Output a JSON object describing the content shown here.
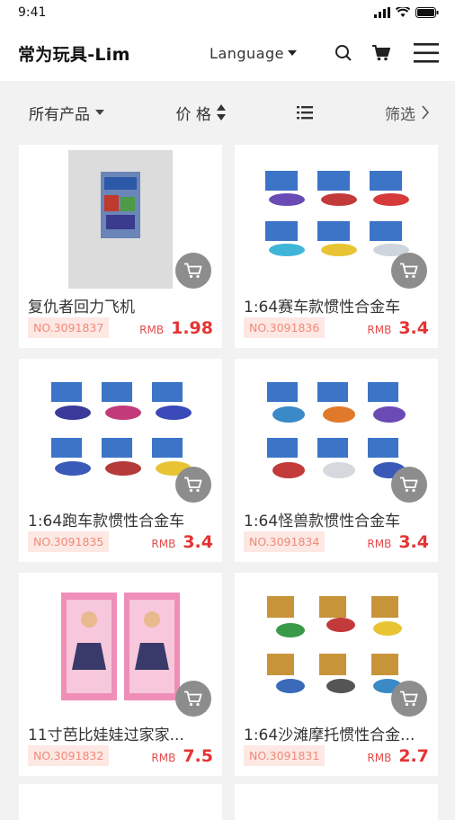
{
  "status": {
    "time": "9:41"
  },
  "header": {
    "brand": "常为玩具-Lim",
    "language": "Language"
  },
  "filters": {
    "all_products": "所有产品",
    "price": "价 格",
    "filter": "筛选"
  },
  "products": [
    {
      "name": "复仇者回力飞机",
      "sku": "NO.3091837",
      "currency": "RMB",
      "price": "1.98"
    },
    {
      "name": "1:64赛车款惯性合金车",
      "sku": "NO.3091836",
      "currency": "RMB",
      "price": "3.4"
    },
    {
      "name": "1:64跑车款惯性合金车",
      "sku": "NO.3091835",
      "currency": "RMB",
      "price": "3.4"
    },
    {
      "name": "1:64怪兽款惯性合金车",
      "sku": "NO.3091834",
      "currency": "RMB",
      "price": "3.4"
    },
    {
      "name": "11寸芭比娃娃过家家...",
      "sku": "NO.3091832",
      "currency": "RMB",
      "price": "7.5"
    },
    {
      "name": "1:64沙滩摩托惯性合金...",
      "sku": "NO.3091831",
      "currency": "RMB",
      "price": "2.7"
    }
  ]
}
